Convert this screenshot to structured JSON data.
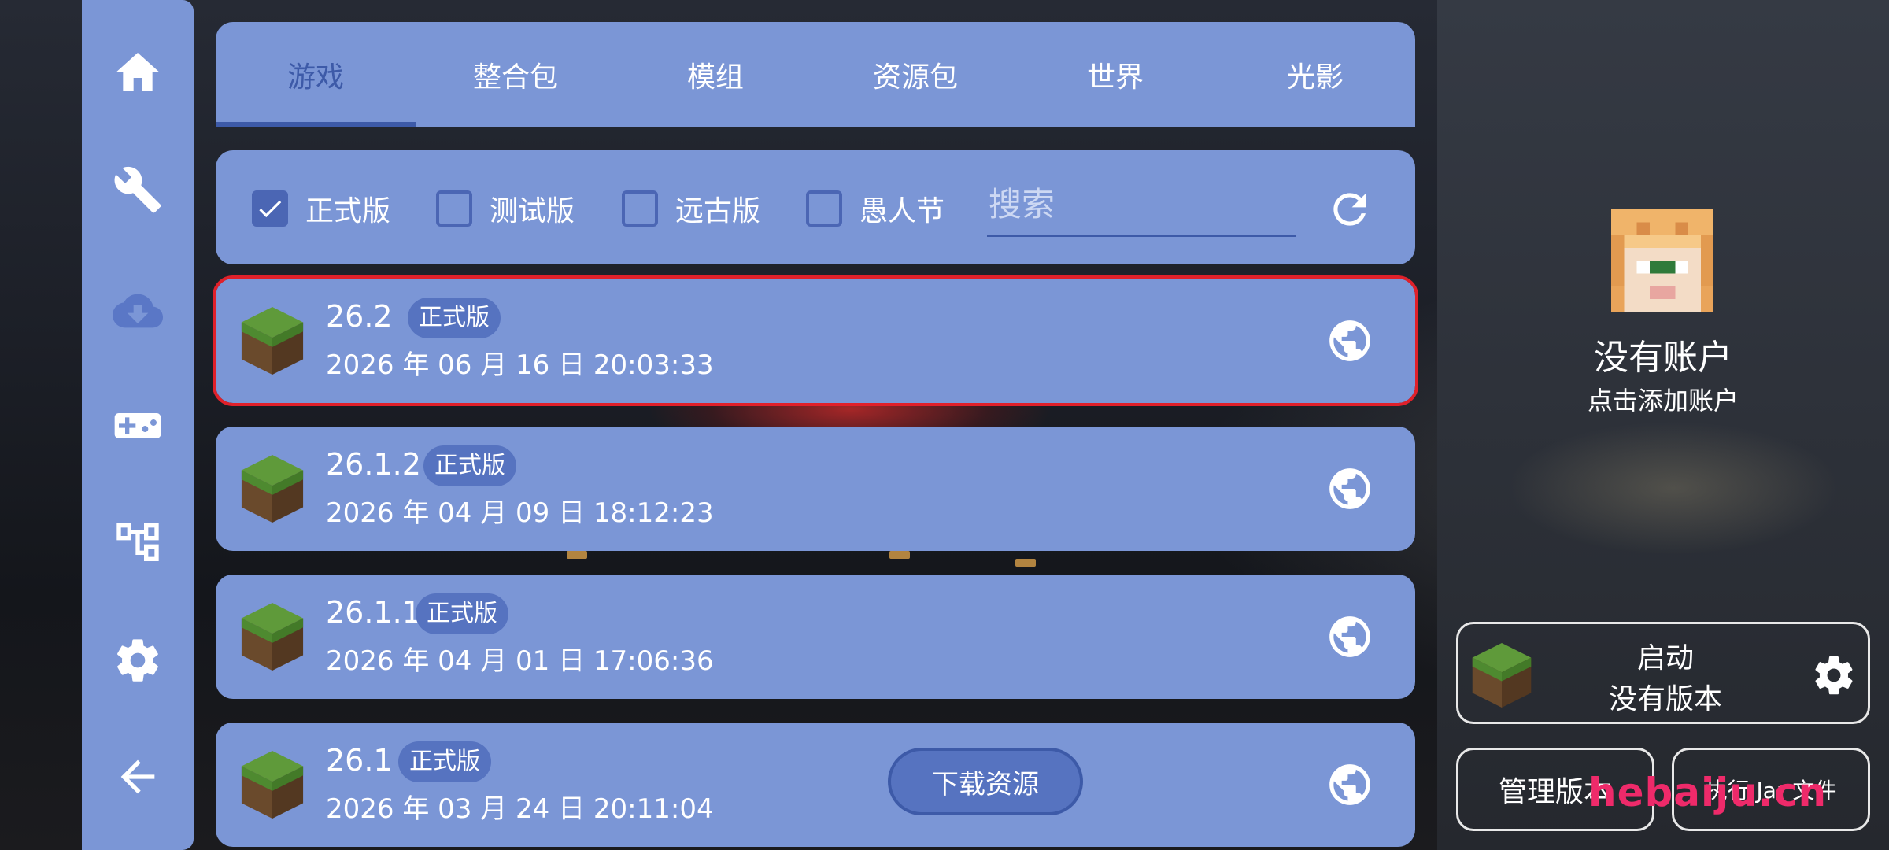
{
  "sidebar": {
    "items": [
      {
        "name": "home",
        "icon": "home-icon"
      },
      {
        "name": "tools",
        "icon": "wrench-icon"
      },
      {
        "name": "download",
        "icon": "cloud-download-icon"
      },
      {
        "name": "controls",
        "icon": "gamepad-icon"
      },
      {
        "name": "tree",
        "icon": "tree-structure-icon"
      },
      {
        "name": "settings",
        "icon": "gear-icon"
      },
      {
        "name": "back",
        "icon": "back-arrow-icon"
      }
    ]
  },
  "tabs": [
    "游戏",
    "整合包",
    "模组",
    "资源包",
    "世界",
    "光影"
  ],
  "active_tab": "游戏",
  "filters": [
    {
      "label": "正式版",
      "checked": true
    },
    {
      "label": "测试版",
      "checked": false
    },
    {
      "label": "远古版",
      "checked": false
    },
    {
      "label": "愚人节",
      "checked": false
    }
  ],
  "search": {
    "placeholder": "搜索",
    "value": ""
  },
  "versions": [
    {
      "version": "26.2",
      "badge": "正式版",
      "date": "2026 年 06 月 16 日 20:03:33",
      "selected": true
    },
    {
      "version": "26.1.2",
      "badge": "正式版",
      "date": "2026 年 04 月 09 日 18:12:23",
      "selected": false
    },
    {
      "version": "26.1.1",
      "badge": "正式版",
      "date": "2026 年 04 月 01 日 17:06:36",
      "selected": false
    },
    {
      "version": "26.1",
      "badge": "正式版",
      "date": "2026 年 03 月 24 日 20:11:04",
      "selected": false
    }
  ],
  "download_button": "下载资源",
  "account": {
    "title": "没有账户",
    "subtitle": "点击添加账户"
  },
  "launch": {
    "title": "启动",
    "subtitle": "没有版本"
  },
  "manage_button": "管理版本",
  "jar_button": "执行 Jar 文件",
  "watermark": "hebaiju.cn",
  "colors": {
    "panel": "#7b96d6",
    "accent": "#3d5aa8",
    "badge": "#5673c0",
    "selection": "#e0202a"
  }
}
